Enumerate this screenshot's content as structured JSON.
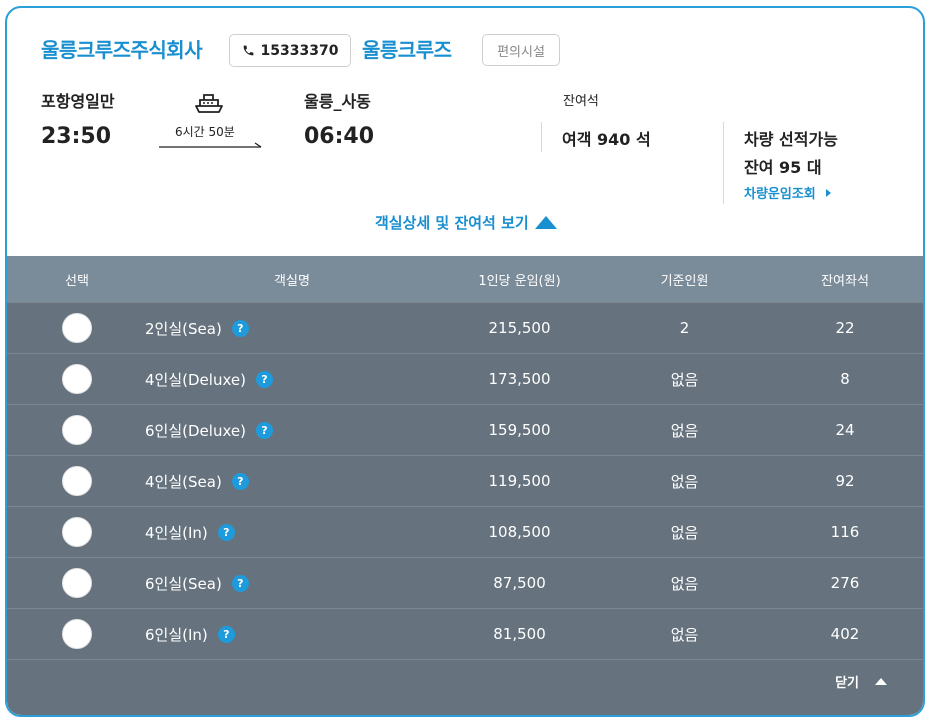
{
  "header": {
    "company": "울릉크루즈주식회사",
    "phone": "15333370",
    "brand": "울릉크루즈",
    "facility_button": "편의시설"
  },
  "route": {
    "departure_port": "포항영일만",
    "departure_time": "23:50",
    "duration": "6시간 50분",
    "arrival_port": "울릉_사동",
    "arrival_time": "06:40"
  },
  "seats": {
    "label": "잔여석",
    "passenger": "여객 940 석",
    "vehicle_line1": "차량 선적가능",
    "vehicle_line2": "잔여 95 대",
    "vehicle_fare_link": "차량운임조회"
  },
  "details_toggle": "객실상세 및 잔여석 보기",
  "table": {
    "headers": [
      "선택",
      "객실명",
      "1인당 운임(원)",
      "기준인원",
      "잔여좌석"
    ],
    "rows": [
      {
        "name": "2인실(Sea)",
        "fare": "215,500",
        "base": "2",
        "remaining": "22"
      },
      {
        "name": "4인실(Deluxe)",
        "fare": "173,500",
        "base": "없음",
        "remaining": "8"
      },
      {
        "name": "6인실(Deluxe)",
        "fare": "159,500",
        "base": "없음",
        "remaining": "24"
      },
      {
        "name": "4인실(Sea)",
        "fare": "119,500",
        "base": "없음",
        "remaining": "92"
      },
      {
        "name": "4인실(In)",
        "fare": "108,500",
        "base": "없음",
        "remaining": "116"
      },
      {
        "name": "6인실(Sea)",
        "fare": "87,500",
        "base": "없음",
        "remaining": "276"
      },
      {
        "name": "6인실(In)",
        "fare": "81,500",
        "base": "없음",
        "remaining": "402"
      }
    ],
    "help_glyph": "?",
    "close_label": "닫기"
  },
  "colors": {
    "accent": "#1a8fd0",
    "table_bg": "#66727e",
    "table_header_bg": "#7a8b9a"
  }
}
